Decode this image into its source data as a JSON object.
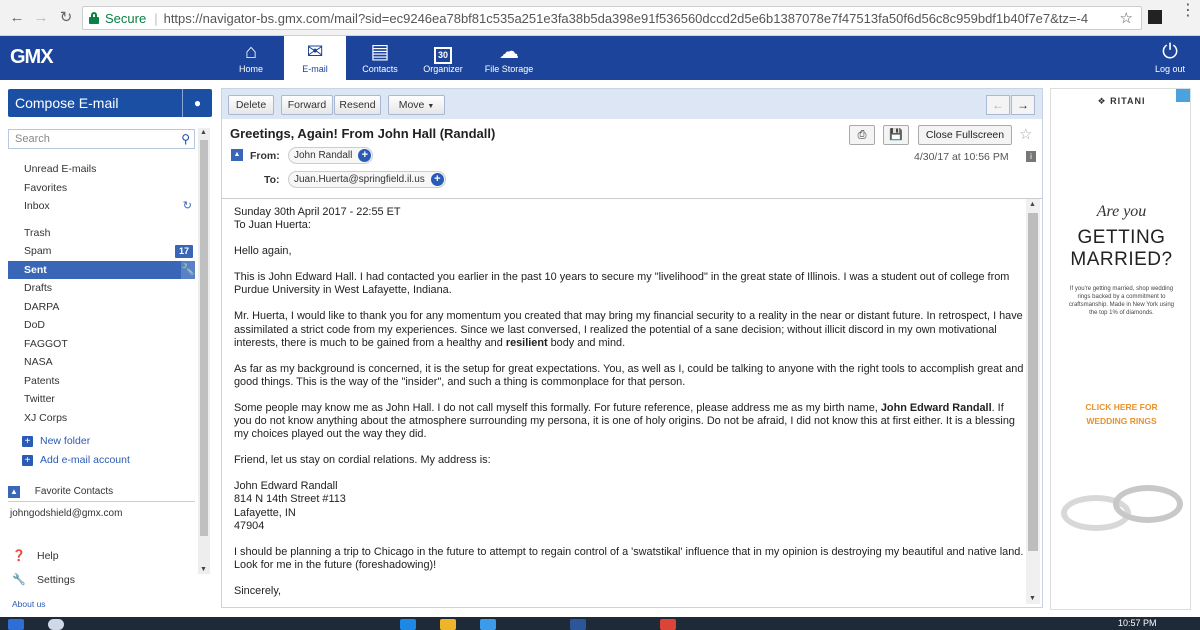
{
  "browser": {
    "secure_label": "Secure",
    "url": "https://navigator-bs.gmx.com/mail?sid=ec9246ea78bf81c535a251e3fa38b5da398e91f536560dccd2d5e6b1387078e7f47513fa50f6d56c8c959bdf1b40f7e7&tz=-4"
  },
  "topnav": {
    "logo": "GMX",
    "items": [
      {
        "label": "Home",
        "icon": "home-icon"
      },
      {
        "label": "E-mail",
        "icon": "envelope-icon"
      },
      {
        "label": "Contacts",
        "icon": "contacts-icon"
      },
      {
        "label": "Organizer",
        "icon": "calendar-icon",
        "icon_text": "30"
      },
      {
        "label": "File Storage",
        "icon": "cloud-icon"
      }
    ],
    "logout": "Log out"
  },
  "sidebar": {
    "compose": "Compose E-mail",
    "search_placeholder": "Search",
    "folders": [
      {
        "label": "Unread E-mails"
      },
      {
        "label": "Favorites"
      },
      {
        "label": "Inbox"
      },
      {
        "label": "Trash"
      },
      {
        "label": "Spam",
        "badge": "17"
      },
      {
        "label": "Sent"
      },
      {
        "label": "Drafts"
      },
      {
        "label": "DARPA"
      },
      {
        "label": "DoD"
      },
      {
        "label": "FAGGOT"
      },
      {
        "label": "NASA"
      },
      {
        "label": "Patents"
      },
      {
        "label": "Twitter"
      },
      {
        "label": "XJ Corps"
      }
    ],
    "new_folder": "New folder",
    "add_account": "Add e-mail account",
    "favorite_contacts": "Favorite Contacts",
    "contact": "johngodshield@gmx.com",
    "help": "Help",
    "settings": "Settings",
    "about": "About us"
  },
  "toolbar": {
    "delete": "Delete",
    "forward": "Forward",
    "resend": "Resend",
    "move": "Move"
  },
  "message": {
    "subject": "Greetings, Again! From John Hall (Randall)",
    "close_fullscreen": "Close Fullscreen",
    "from_label": "From:",
    "from": "John Randall",
    "to_label": "To:",
    "to": "Juan.Huerta@springfield.il.us",
    "date": "4/30/17 at 10:56 PM",
    "body": {
      "line1": "Sunday 30th April 2017 - 22:55 ET",
      "line2": "To Juan Huerta:",
      "greeting": "Hello again,",
      "p1": "This is John Edward Hall. I had contacted you earlier in the past 10 years to secure my \"livelihood\" in the great state of Illinois. I was a student out of college from Purdue University in West Lafayette, Indiana.",
      "p2a": "Mr. Huerta, I would like to thank you for any momentum you created that may bring my financial security to a reality in the near or distant future. In retrospect, I have assimilated a strict code from my experiences. Since we last conversed, I realized the potential of a sane decision; without illicit discord in my own motivational interests, there is much to be gained from a healthy and ",
      "p2b": "resilient",
      "p2c": " body and mind.",
      "p3": "As far as my background is concerned, it is the setup for great expectations. You, as well as I, could be talking to anyone with the right tools to accomplish great and good things. This is the way of the \"insider\", and such a thing is commonplace for that person.",
      "p4a": "Some people may know me as John Hall. I do not call myself this formally. For future reference, please address me as my birth name, ",
      "p4b": "John Edward Randall",
      "p4c": ". If you do not know anything about the atmosphere surrounding my persona, it is one of holy origins. Do not be afraid, I did not know this at first either. It is a blessing my choices played out the way they did.",
      "p5": "Friend, let us stay on cordial relations. My address is:",
      "addr1": "John Edward Randall",
      "addr2": "814 N 14th Street #113",
      "addr3": "Lafayette, IN",
      "addr4": "47904",
      "p6": "I should be planning a trip to Chicago in the future to attempt to regain control of a 'swatstikal' influence that in my opinion is destroying my beautiful and native land. Look for me in the future (foreshadowing)!",
      "closing": "Sincerely,"
    }
  },
  "ad": {
    "brand": "RITANI",
    "question": "Are you",
    "headline1": "GETTING",
    "headline2": "MARRIED?",
    "small": "If you're getting married, shop wedding rings backed by a commitment to craftsmanship. Made in New York using the top 1% of diamonds.",
    "cta1": "CLICK HERE FOR",
    "cta2": "WEDDING RINGS"
  },
  "taskbar": {
    "clock": "10:57 PM"
  }
}
